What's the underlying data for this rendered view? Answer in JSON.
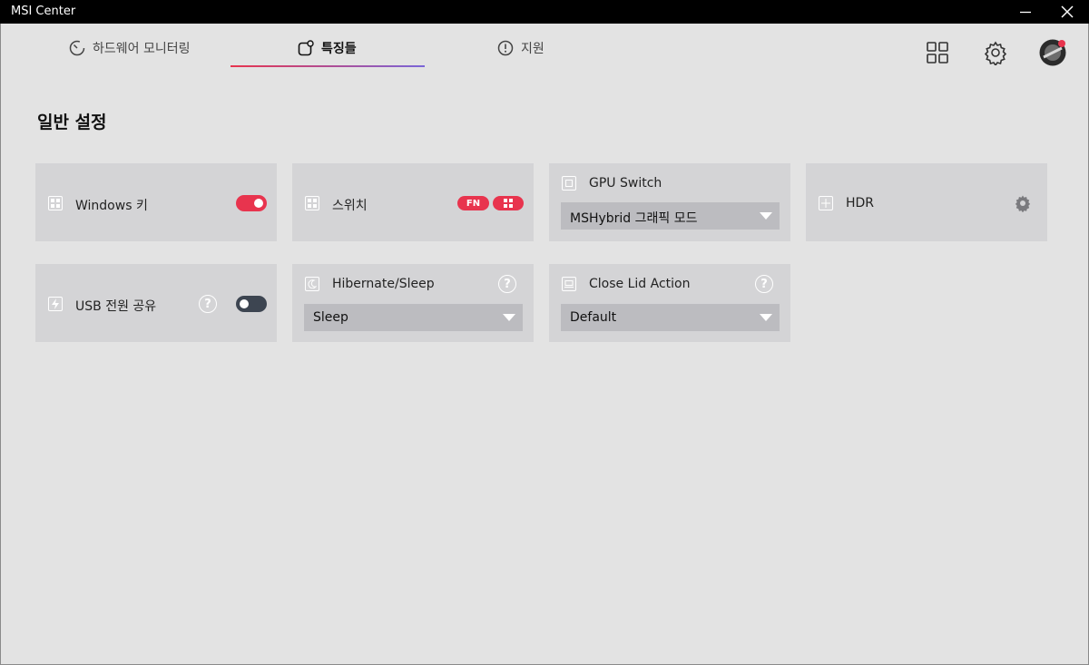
{
  "window": {
    "title": "MSI Center"
  },
  "tabs": [
    {
      "label": "하드웨어 모니터링"
    },
    {
      "label": "특징들"
    },
    {
      "label": "지원"
    }
  ],
  "section": {
    "title": "일반 설정"
  },
  "cards": {
    "windows_key": {
      "label": "Windows 키",
      "toggle_on": true
    },
    "switch": {
      "label": "스위치",
      "badge_fn": "FN"
    },
    "gpu_switch": {
      "label": "GPU Switch",
      "value": "MSHybrid 그래픽 모드"
    },
    "hdr": {
      "label": "HDR"
    },
    "usb_power": {
      "label": "USB 전원 공유",
      "help": "?",
      "toggle_on": false
    },
    "hibernate": {
      "label": "Hibernate/Sleep",
      "help": "?",
      "value": "Sleep"
    },
    "close_lid": {
      "label": "Close Lid Action",
      "help": "?",
      "value": "Default"
    }
  },
  "colors": {
    "accent": "#e8344e",
    "accent2": "#7a66d8",
    "card_bg": "#d4d4d6",
    "page_bg": "#e3e3e3"
  }
}
